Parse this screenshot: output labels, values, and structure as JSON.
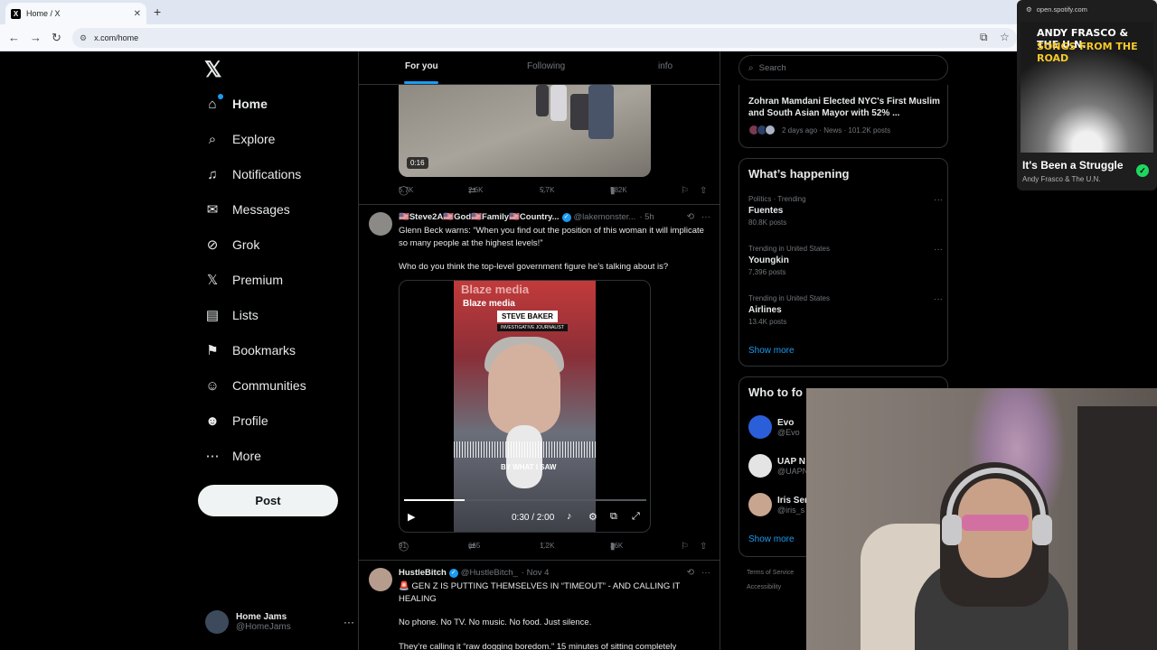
{
  "browser": {
    "tab_title": "Home / X",
    "favicon": "X",
    "url": "x.com/home"
  },
  "nav": {
    "items": [
      {
        "label": "Home",
        "icon": "home-icon"
      },
      {
        "label": "Explore",
        "icon": "search-icon"
      },
      {
        "label": "Notifications",
        "icon": "bell-icon"
      },
      {
        "label": "Messages",
        "icon": "mail-icon"
      },
      {
        "label": "Grok",
        "icon": "grok-icon"
      },
      {
        "label": "Premium",
        "icon": "x-icon"
      },
      {
        "label": "Lists",
        "icon": "list-icon"
      },
      {
        "label": "Bookmarks",
        "icon": "bookmark-icon"
      },
      {
        "label": "Communities",
        "icon": "communities-icon"
      },
      {
        "label": "Profile",
        "icon": "profile-icon"
      },
      {
        "label": "More",
        "icon": "more-icon"
      }
    ],
    "post_label": "Post",
    "account": {
      "name": "Home Jams",
      "handle": "@HomeJams"
    }
  },
  "feed": {
    "tabs": [
      "For you",
      "Following",
      "info"
    ],
    "post1": {
      "duration": "0:16",
      "replies": "5.7K",
      "reposts": "2.6K",
      "likes": "5.7K",
      "views": "582K"
    },
    "post2": {
      "name": "🇺🇸Steve2A🇺🇸God🇺🇸Family🇺🇸Country...",
      "handle": "@lakemonster...",
      "time": "· 5h",
      "text1": "Glenn Beck warns: “When you find out the position of this woman it will implicate so many people at the highest levels!”",
      "text2": "Who do you think the top-level government figure he’s talking about is?",
      "video": {
        "brand": "Blaze media",
        "name_card": "STEVE BAKER",
        "sub_card": "INVESTIGATIVE JOURNALIST",
        "caption": "BY WHAT I SAW",
        "time": "0:30 / 2:00",
        "progress": 0.25
      },
      "replies": "91",
      "reposts": "665",
      "likes": "1.2K",
      "views": "36K"
    },
    "post3": {
      "name": "HustleBitch",
      "handle": "@HustleBitch_",
      "time": "· Nov 4",
      "text1": "🚨 GEN Z IS PUTTING THEMSELVES IN “TIMEOUT” - AND CALLING IT HEALING",
      "text2": "No phone. No TV. No music. No food. Just silence.",
      "text3": "They’re calling it “raw dogging boredom.” 15 minutes of sitting completely"
    }
  },
  "right": {
    "search_placeholder": "Search",
    "news": {
      "headline": "Zohran Mamdani Elected NYC's First Muslim and South Asian Mayor with 52% ...",
      "meta": "2 days ago · News · 101.2K posts"
    },
    "happening_title": "What’s happening",
    "trends": [
      {
        "context": "Politics · Trending",
        "topic": "Fuentes",
        "count": "80.8K posts"
      },
      {
        "context": "Trending in United States",
        "topic": "Youngkin",
        "count": "7,396 posts"
      },
      {
        "context": "Trending in United States",
        "topic": "Airlines",
        "count": "13.4K posts"
      }
    ],
    "show_more": "Show more",
    "wtf_title": "Who to fo",
    "follows": [
      {
        "name": "Evo",
        "handle": "@Evo"
      },
      {
        "name": "UAP N",
        "handle": "@UAPN"
      },
      {
        "name": "Iris Ser",
        "handle": "@iris_s"
      }
    ],
    "footer1": "Terms of Service",
    "footer2": "Accessibility"
  },
  "spotify": {
    "host": "open.spotify.com",
    "art_line1": "ANDY FRASCO & THE U.N.",
    "art_line2": "SONGS FROM THE ROAD",
    "song": "It's Been a Struggle",
    "artist": "Andy Frasco & The U.N."
  }
}
